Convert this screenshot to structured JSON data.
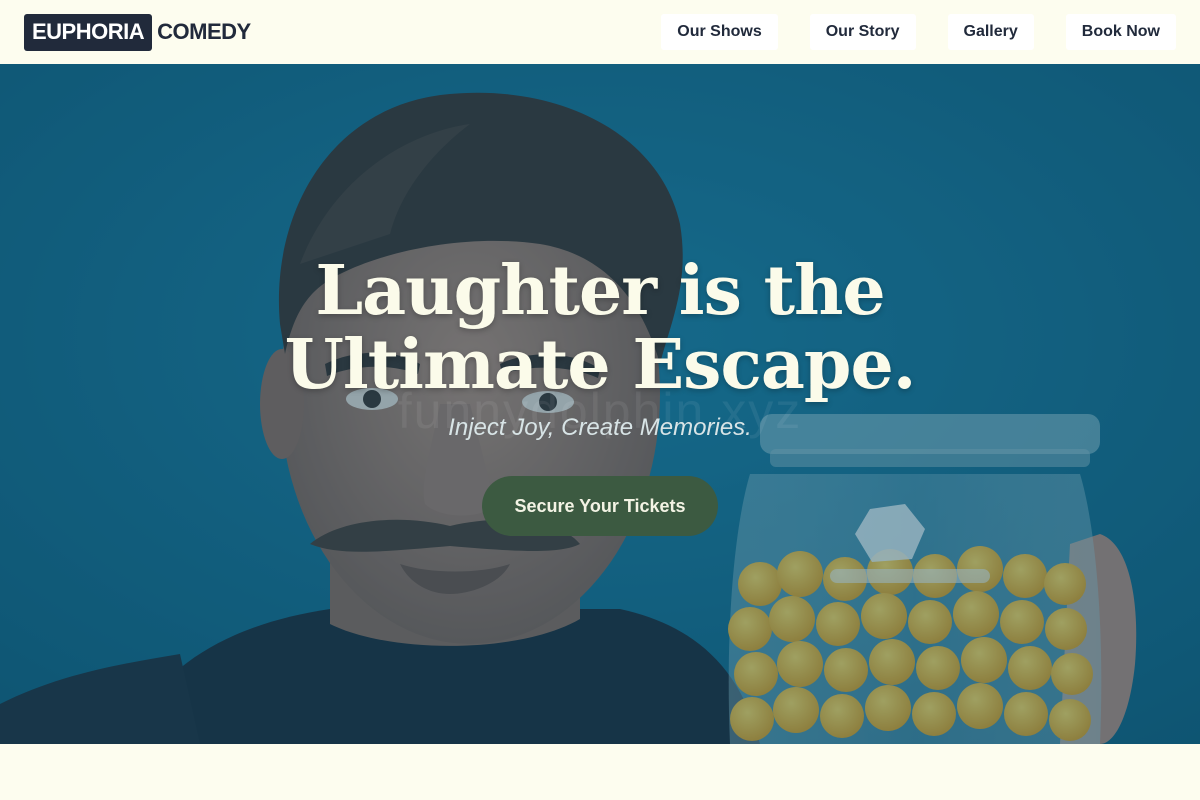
{
  "brand": {
    "logo_boxed": "EUPHORIA",
    "logo_text": "COMEDY"
  },
  "nav": {
    "items": [
      {
        "label": "Our Shows"
      },
      {
        "label": "Our Story"
      },
      {
        "label": "Gallery"
      },
      {
        "label": "Book Now"
      }
    ]
  },
  "hero": {
    "title": "Laughter is the Ultimate Escape.",
    "subtitle": "Inject Joy, Create Memories.",
    "cta_label": "Secure Your Tickets",
    "watermark": "funnydolphin.xyz"
  },
  "colors": {
    "background": "#fdfdef",
    "brand_dark": "#212a3b",
    "hero_teal": "#11607d",
    "cta_green": "#3c5a41"
  }
}
